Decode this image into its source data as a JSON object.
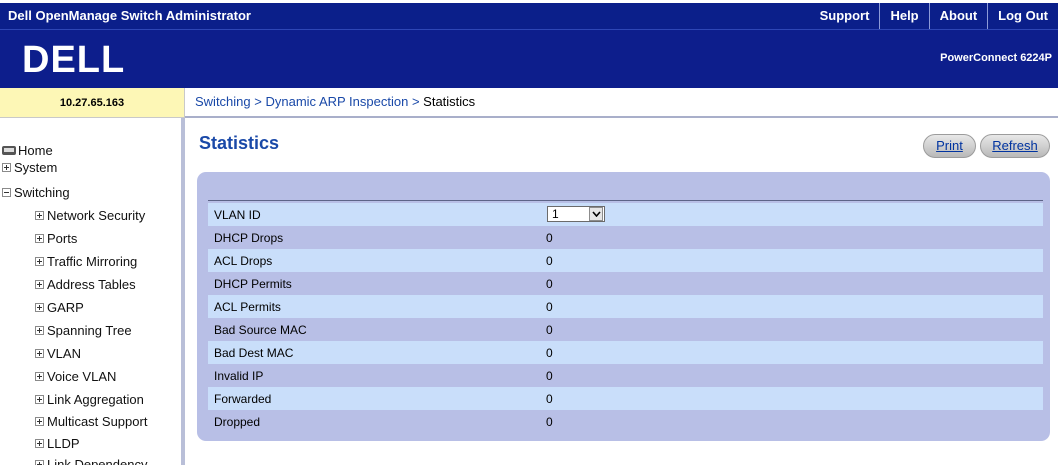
{
  "topbar": {
    "title": "Dell OpenManage Switch Administrator",
    "links": [
      "Support",
      "Help",
      "About",
      "Log Out"
    ]
  },
  "banner": {
    "logo_text": "DELL",
    "model": "PowerConnect 6224P"
  },
  "ip_address": "10.27.65.163",
  "breadcrumb": {
    "items": [
      "Switching",
      "Dynamic ARP Inspection",
      "Statistics"
    ],
    "separator": ">"
  },
  "leftnav": {
    "items": [
      {
        "label": "Home",
        "icon": "book-icon"
      },
      {
        "label": "System",
        "icon": "plus-box-icon"
      },
      {
        "label": "Switching",
        "icon": "minus-box-icon"
      },
      {
        "label": "Network Security",
        "icon": "plus-box-icon"
      },
      {
        "label": "Ports",
        "icon": "plus-box-icon"
      },
      {
        "label": "Traffic Mirroring",
        "icon": "plus-box-icon"
      },
      {
        "label": "Address Tables",
        "icon": "plus-box-icon"
      },
      {
        "label": "GARP",
        "icon": "plus-box-icon"
      },
      {
        "label": "Spanning Tree",
        "icon": "plus-box-icon"
      },
      {
        "label": "VLAN",
        "icon": "plus-box-icon"
      },
      {
        "label": "Voice VLAN",
        "icon": "plus-box-icon"
      },
      {
        "label": "Link Aggregation",
        "icon": "plus-box-icon"
      },
      {
        "label": "Multicast Support",
        "icon": "plus-box-icon"
      },
      {
        "label": "LLDP",
        "icon": "plus-box-icon"
      },
      {
        "label": "Link Dependency",
        "icon": "plus-box-icon"
      }
    ]
  },
  "main": {
    "title": "Statistics",
    "print_label": "Print",
    "refresh_label": "Refresh",
    "vlan_label": "VLAN ID",
    "vlan_value": "1",
    "stats": [
      {
        "label": "DHCP Drops",
        "value": "0"
      },
      {
        "label": "ACL Drops",
        "value": "0"
      },
      {
        "label": "DHCP Permits",
        "value": "0"
      },
      {
        "label": "ACL Permits",
        "value": "0"
      },
      {
        "label": "Bad Source MAC",
        "value": "0"
      },
      {
        "label": "Bad Dest MAC",
        "value": "0"
      },
      {
        "label": "Invalid IP",
        "value": "0"
      },
      {
        "label": "Forwarded",
        "value": "0"
      },
      {
        "label": "Dropped",
        "value": "0"
      }
    ]
  },
  "colors": {
    "topbar": "#0b1f8a",
    "banner": "#0d1e8c",
    "ip_box": "#fdf7b6",
    "panel": "#b8bfe6",
    "row_highlight": "#c9defa",
    "title_blue": "#1a49a8"
  }
}
